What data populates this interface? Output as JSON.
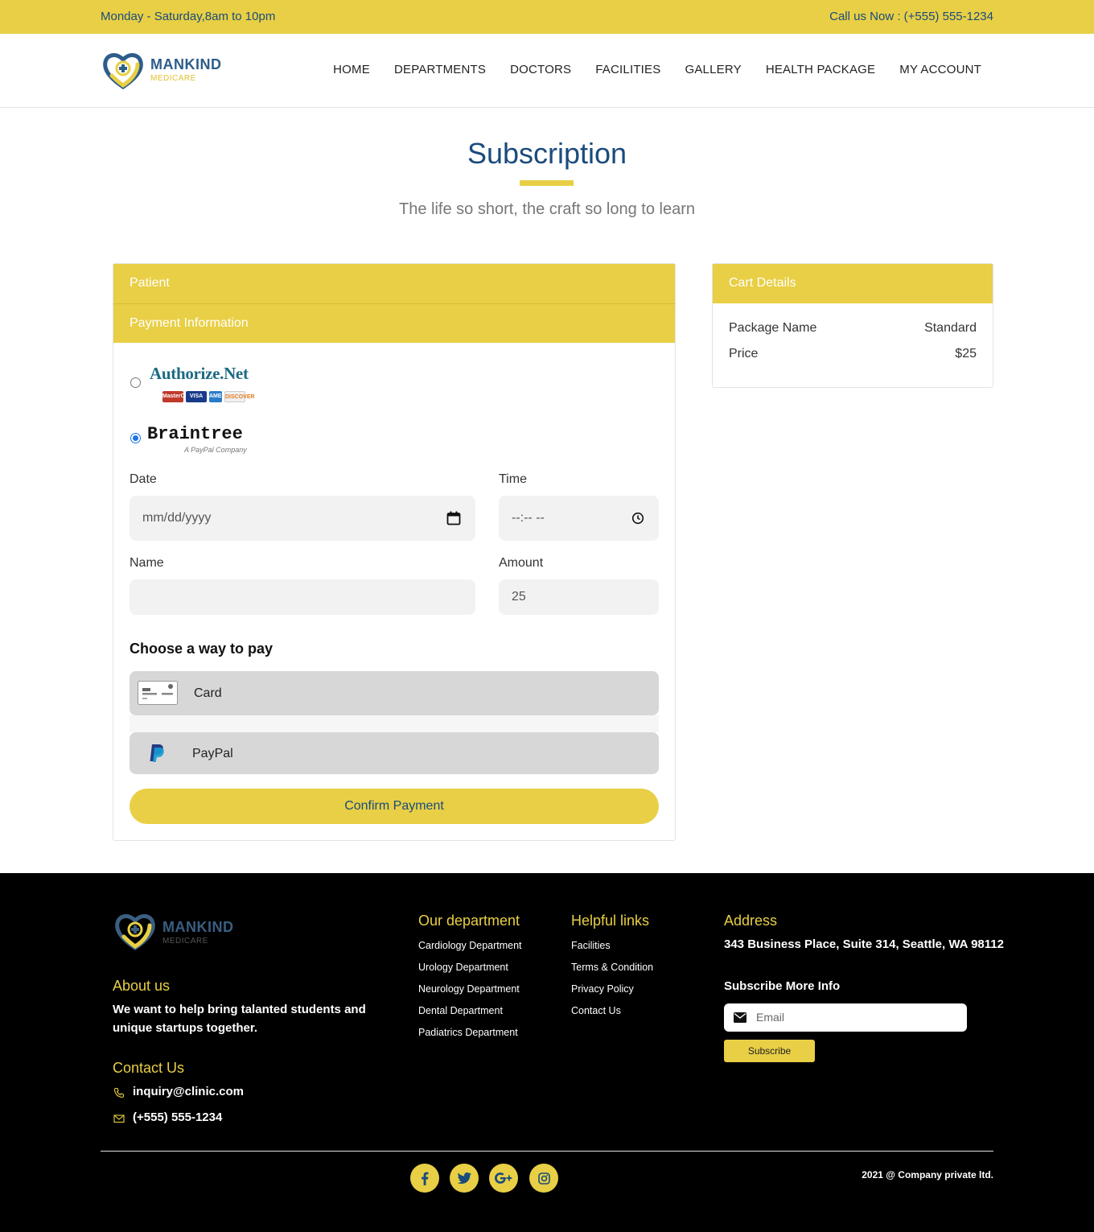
{
  "topbar": {
    "hours": "Monday - Saturday,8am to 10pm",
    "call": "Call us Now : (+555) 555-1234"
  },
  "logo": {
    "brand": "MANKIND",
    "sub": "MEDICARE"
  },
  "nav": {
    "items": [
      "HOME",
      "DEPARTMENTS",
      "DOCTORS",
      "FACILITIES",
      "GALLERY",
      "HEALTH PACKAGE",
      "MY ACCOUNT"
    ]
  },
  "hero": {
    "title": "Subscription",
    "subtitle": "The life so short, the craft so long to learn"
  },
  "form": {
    "patient_label": "Patient",
    "payment_label": "Payment Information",
    "gateways": {
      "authorize": {
        "name": "Authorize.Net",
        "cards": [
          "MasterCard",
          "VISA",
          "AMEX",
          "DISCOVER"
        ],
        "selected": false
      },
      "braintree": {
        "name": "Braintree",
        "tagline": "A PayPal Company",
        "selected": true
      }
    },
    "date": {
      "label": "Date",
      "placeholder": "mm/dd/yyyy"
    },
    "time": {
      "label": "Time",
      "placeholder": "--:-- --"
    },
    "name": {
      "label": "Name",
      "value": ""
    },
    "amount": {
      "label": "Amount",
      "value": "25"
    },
    "choose_title": "Choose a way to pay",
    "options": {
      "card": "Card",
      "paypal": "PayPal"
    },
    "confirm": "Confirm Payment"
  },
  "cart": {
    "title": "Cart Details",
    "package_label": "Package Name",
    "package_value": "Standard",
    "price_label": "Price",
    "price_value": "$25"
  },
  "footer": {
    "about_title": "About us",
    "about_text": "We want to help bring talanted students and unique startups together.",
    "contact_title": "Contact Us",
    "email": "inquiry@clinic.com",
    "phone": "(+555) 555-1234",
    "dept_title": "Our department",
    "departments": [
      "Cardiology Department",
      "Urology Department",
      "Neurology Department",
      "Dental Department",
      "Padiatrics Department"
    ],
    "links_title": "Helpful links",
    "links": [
      "Facilities",
      "Terms & Condition",
      "Privacy Policy",
      "Contact Us"
    ],
    "address_title": "Address",
    "address": "343 Business Place, Suite 314, Seattle, WA 98112",
    "subscribe_title": "Subscribe More Info",
    "email_placeholder": "Email",
    "subscribe_button": "Subscribe",
    "copyright": "2021 @ Company private ltd.",
    "social": [
      "facebook-icon",
      "twitter-icon",
      "google-plus-icon",
      "instagram-icon"
    ]
  },
  "colors": {
    "accent": "#e8cf45",
    "primary": "#1a4b7c",
    "footer_bg": "#000000"
  }
}
